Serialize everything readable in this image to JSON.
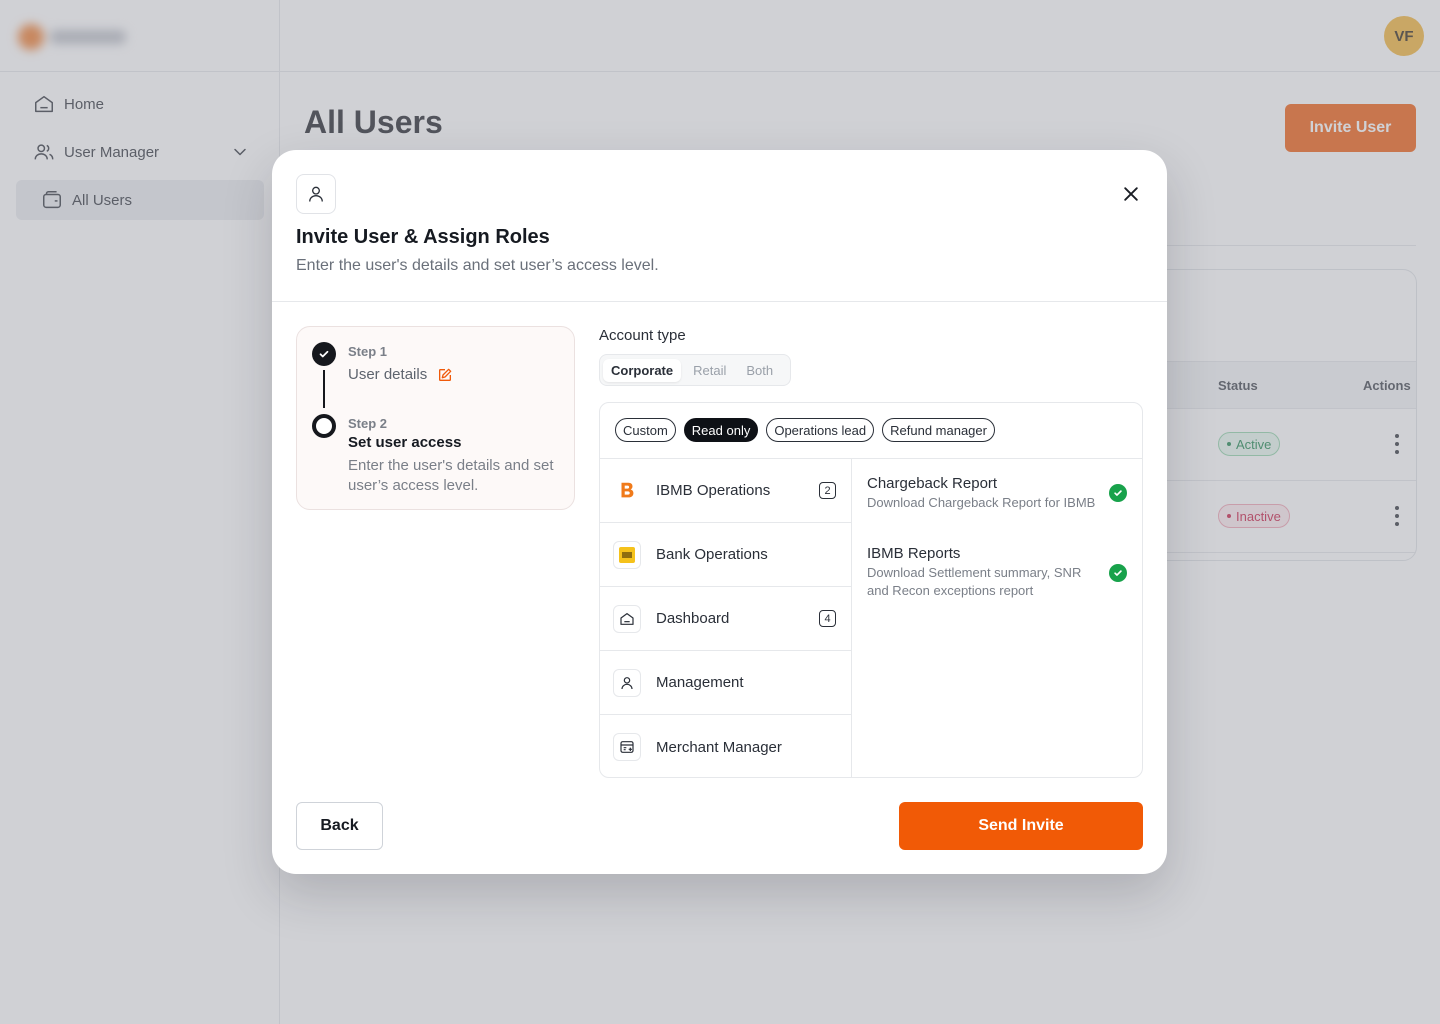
{
  "sidebar": {
    "items": [
      {
        "label": "Home",
        "icon": "home-icon"
      },
      {
        "label": "User Manager",
        "icon": "users-icon"
      },
      {
        "label": "All Users",
        "icon": "wallet-icon"
      }
    ]
  },
  "header": {
    "avatar_initials": "VF"
  },
  "main": {
    "title": "All Users",
    "invite_label": "Invite User",
    "table": {
      "columns": [
        "Status",
        "Actions"
      ],
      "rows": [
        {
          "status": "Active"
        },
        {
          "status": "Inactive"
        }
      ]
    }
  },
  "modal": {
    "title": "Invite User & Assign Roles",
    "subtitle": "Enter the user's details and set user’s access level.",
    "steps": [
      {
        "label": "Step 1",
        "value": "User details",
        "state": "complete"
      },
      {
        "label": "Step 2",
        "value": "Set user access",
        "description": "Enter the user's details and set user’s access level.",
        "state": "current"
      }
    ],
    "account_type": {
      "label": "Account type",
      "options": [
        "Corporate",
        "Retail",
        "Both"
      ],
      "selected": "Corporate"
    },
    "role_chips": [
      "Custom",
      "Read only",
      "Operations lead",
      "Refund manager"
    ],
    "selected_role": "Read only",
    "modules": [
      {
        "name": "IBMB Operations",
        "count": "2",
        "icon": "ibmb-logo-icon"
      },
      {
        "name": "Bank Operations",
        "count": "",
        "icon": "bank-logo-icon"
      },
      {
        "name": "Dashboard",
        "count": "4",
        "icon": "home-icon"
      },
      {
        "name": "Management",
        "count": "",
        "icon": "user-icon"
      },
      {
        "name": "Merchant Manager",
        "count": "",
        "icon": "merchant-icon"
      }
    ],
    "permissions": [
      {
        "title": "Chargeback Report",
        "description": "Download Chargeback Report for IBMB",
        "checked": true
      },
      {
        "title": "IBMB Reports",
        "description": "Download Settlement summary, SNR and Recon exceptions report",
        "checked": true
      }
    ],
    "back_label": "Back",
    "send_label": "Send Invite"
  },
  "colors": {
    "accent": "#F05A0A",
    "success": "#18A24B",
    "danger": "#C8173F",
    "avatar": "#F2B233"
  }
}
